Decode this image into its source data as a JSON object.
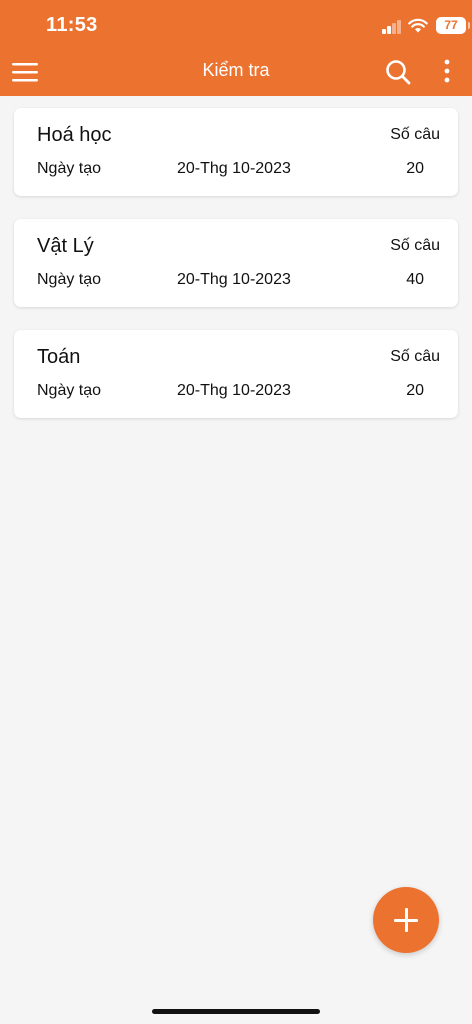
{
  "status_bar": {
    "time": "11:53",
    "battery": "77"
  },
  "appbar": {
    "title": "Kiểm tra"
  },
  "tests": [
    {
      "name": "Hoá học",
      "date_label": "Ngày tạo",
      "date": "20-Thg 10-2023",
      "count_label": "Số câu",
      "count": "20"
    },
    {
      "name": "Vật Lý",
      "date_label": "Ngày tạo",
      "date": "20-Thg 10-2023",
      "count_label": "Số câu",
      "count": "40"
    },
    {
      "name": "Toán",
      "date_label": "Ngày tạo",
      "date": "20-Thg 10-2023",
      "count_label": "Số câu",
      "count": "20"
    }
  ],
  "icons": {
    "menu": "menu-icon",
    "search": "search-icon",
    "more": "more-vertical-icon",
    "add": "plus-icon"
  },
  "colors": {
    "primary": "#ec7230",
    "background": "#f5f5f5",
    "card": "#ffffff"
  }
}
